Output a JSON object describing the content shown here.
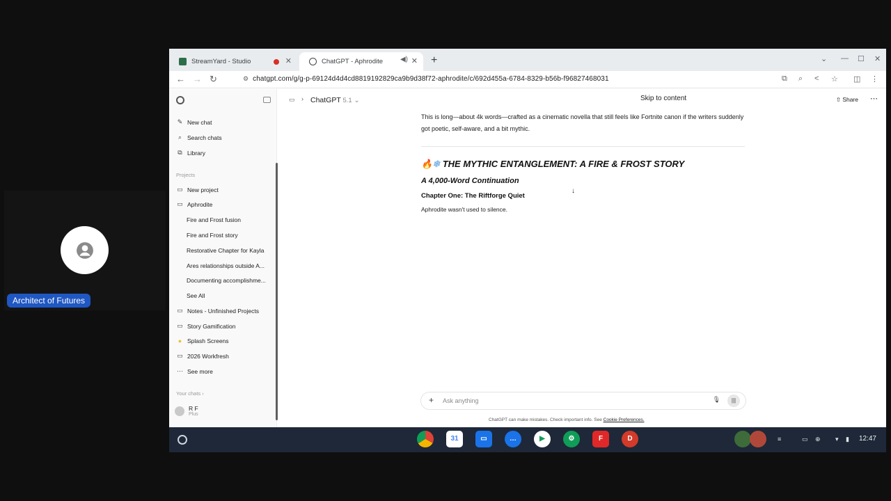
{
  "participant": {
    "name": "Architect of Futures"
  },
  "browser": {
    "tabs": [
      {
        "title": "StreamYard - Studio",
        "active": false
      },
      {
        "title": "ChatGPT - Aphrodite",
        "active": true
      }
    ],
    "new_tab_label": "+",
    "url": "chatgpt.com/g/g-p-69124d4d4cd8819192829ca9b9d38f72-aphrodite/c/692d455a-6784-8329-b56b-f96827468031"
  },
  "sidebar": {
    "top_items": [
      {
        "label": "New chat",
        "icon": "edit-icon"
      },
      {
        "label": "Search chats",
        "icon": "search-icon"
      },
      {
        "label": "Library",
        "icon": "library-icon"
      }
    ],
    "projects_label": "Projects",
    "new_project": "New project",
    "project": "Aphrodite",
    "project_chats": [
      "Fire and Frost fusion",
      "Fire and Frost story",
      "Restorative Chapter for Kayla",
      "Ares relationships outside A...",
      "Documenting accomplishme...",
      "See All"
    ],
    "folders": [
      {
        "label": "Notes - Unfinished Projects",
        "icon": "folder-icon"
      },
      {
        "label": "Story Gamification",
        "icon": "folder-icon"
      },
      {
        "label": "Splash Screens",
        "icon": "folder-yellow-icon"
      },
      {
        "label": "2026 Workfresh",
        "icon": "folder-icon"
      },
      {
        "label": "See more",
        "icon": "more-icon"
      }
    ],
    "your_chats_label": "Your chats",
    "user": {
      "name": "R F",
      "plan": "Plus"
    }
  },
  "topbar": {
    "model": "ChatGPT",
    "model_version": "5.1",
    "skip_link": "Skip to content",
    "share": "Share"
  },
  "content": {
    "intro": "This is long—about 4k words—crafted as a cinematic novella that still feels like Fortnite canon if the writers suddenly got poetic, self-aware, and a bit mythic.",
    "title": "THE MYTHIC ENTANGLEMENT: A FIRE & FROST STORY",
    "subtitle": "A 4,000-Word Continuation",
    "chapter": "Chapter One: The Riftforge Quiet",
    "first_line": "Aphrodite wasn't used to silence."
  },
  "composer": {
    "placeholder": "Ask anything",
    "disclaimer": "ChatGPT can make mistakes. Check important info. See",
    "disclaimer_link": "Cookie Preferences."
  },
  "taskbar": {
    "apps": [
      "chrome-icon",
      "calendar-icon",
      "files-icon",
      "messages-icon",
      "play-store-icon",
      "settings-icon",
      "flipboard-icon",
      "dashlane-icon"
    ],
    "clock": "12:47"
  }
}
